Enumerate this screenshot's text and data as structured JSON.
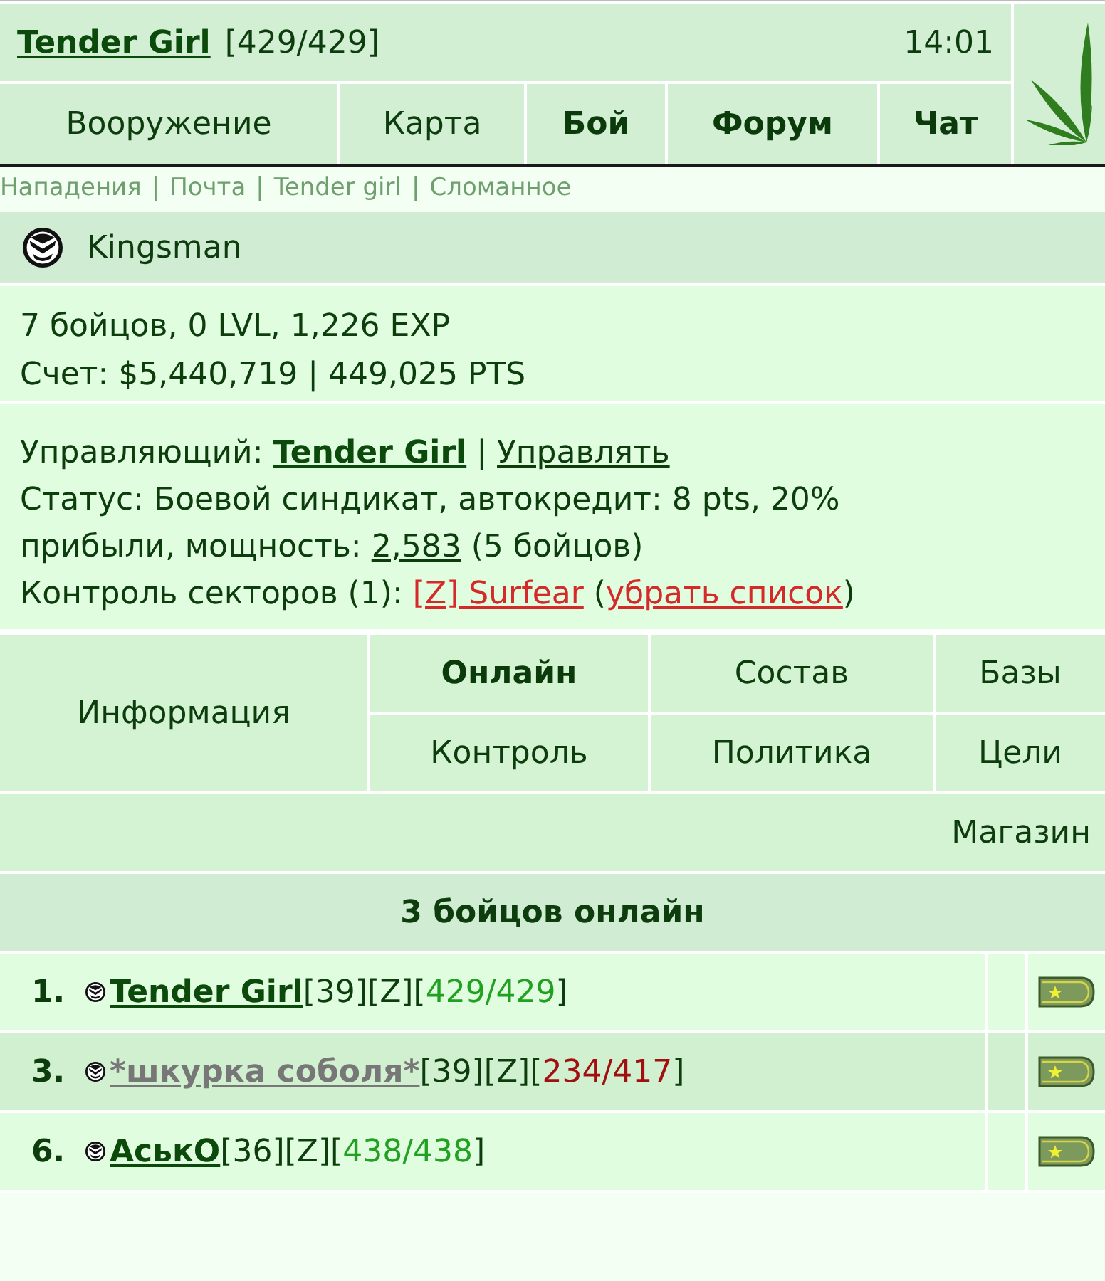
{
  "header": {
    "player": {
      "name": "Tender Girl",
      "hp": "[429/429]"
    },
    "time": "14:01"
  },
  "tabs": [
    {
      "label": "Вооружение",
      "highlighted": false
    },
    {
      "label": "Карта",
      "highlighted": false
    },
    {
      "label": "Бой",
      "highlighted": true
    },
    {
      "label": "Форум",
      "highlighted": true
    },
    {
      "label": "Чат",
      "highlighted": true
    }
  ],
  "quick_links": {
    "items": [
      "Нападения",
      "Почта",
      "Tender girl",
      "Сломанное"
    ],
    "separator": "|"
  },
  "clan": {
    "name": "Kingsman",
    "stats": [
      "7 бойцов, 0 LVL, 1,226 EXP",
      "Счет: $5,440,719 | 449,025 PTS"
    ],
    "manager": {
      "label": "Управляющий:",
      "name": "Tender Girl",
      "separator": "|",
      "action": "Управлять"
    },
    "status": {
      "text": "Статус: Боевой синдикат, автокредит: 8 pts, 20% прибыли, мощность:",
      "power": "2,583",
      "note": "(5 бойцов)"
    },
    "sectors": {
      "label": "Контроль секторов (1):",
      "sector": "[Z] Surfear",
      "open": "(",
      "remove": "убрать список",
      "close": ")"
    }
  },
  "clan_menu": [
    {
      "label": "Информация",
      "selected": false
    },
    {
      "label": "Онлайн",
      "selected": true
    },
    {
      "label": "Состав",
      "selected": false
    },
    {
      "label": "Базы",
      "selected": false
    },
    {
      "label": "Контроль",
      "selected": false
    },
    {
      "label": "Политика",
      "selected": false
    },
    {
      "label": "Цели",
      "selected": false
    },
    {
      "label": "Магазин",
      "selected": false
    }
  ],
  "online": {
    "title": "3 бойцов онлайн",
    "members": [
      {
        "number": "1.",
        "name": {
          "text": "Tender Girl",
          "color": "#0b4a0b"
        },
        "level": "[39]",
        "faction": "[Z]",
        "hp": {
          "open": "[",
          "value": "429/429",
          "close": "]",
          "color": "#22a022"
        }
      },
      {
        "number": "3.",
        "name": {
          "text": "*шкурка соболя*",
          "color": "#777777"
        },
        "level": "[39]",
        "faction": "[Z]",
        "hp": {
          "open": "[",
          "value": "234/417",
          "close": "]",
          "color": "#a01010"
        }
      },
      {
        "number": "6.",
        "name": {
          "text": "АськО",
          "color": "#0b4a0b"
        },
        "level": "[36]",
        "faction": "[Z]",
        "hp": {
          "open": "[",
          "value": "438/438",
          "close": "]",
          "color": "#22a022"
        }
      }
    ]
  }
}
